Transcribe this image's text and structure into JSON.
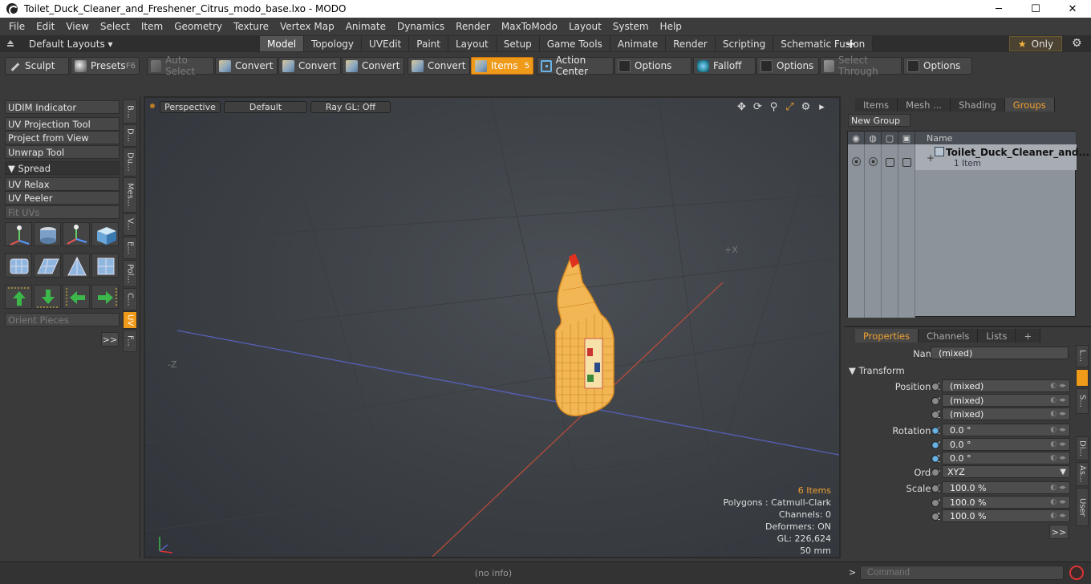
{
  "window": {
    "title": "Toilet_Duck_Cleaner_and_Freshener_Citrus_modo_base.lxo - MODO",
    "minimize": "─",
    "maximize": "☐",
    "close": "✕"
  },
  "menu": [
    "File",
    "Edit",
    "View",
    "Select",
    "Item",
    "Geometry",
    "Texture",
    "Vertex Map",
    "Animate",
    "Dynamics",
    "Render",
    "MaxToModo",
    "Layout",
    "System",
    "Help"
  ],
  "layoutbar": {
    "layouts_label": "Default Layouts ▾",
    "tabs": [
      "Model",
      "Topology",
      "UVEdit",
      "Paint",
      "Layout",
      "Setup",
      "Game Tools",
      "Animate",
      "Render",
      "Scripting",
      "Schematic Fusion"
    ],
    "active_tab": "Model",
    "plus": "+",
    "only_label": "Only",
    "star": "★",
    "gear": "⚙"
  },
  "toolbar": {
    "sculpt": "Sculpt",
    "presets": "Presets",
    "presets_key": "F6",
    "auto_select": "Auto Select",
    "convert1": "Convert",
    "convert2": "Convert",
    "convert3": "Convert",
    "convert4": "Convert",
    "items": "Items",
    "items_key": "5",
    "action_center": "Action Center",
    "options1": "Options",
    "falloff": "Falloff",
    "options2": "Options",
    "select_through": "Select Through",
    "options3": "Options"
  },
  "leftpanel": {
    "udim": "UDIM Indicator",
    "uv_projection": "UV Projection Tool",
    "project_from_view": "Project from View",
    "unwrap": "Unwrap Tool",
    "spread": "▼  Spread",
    "uv_relax": "UV Relax",
    "uv_peeler": "UV Peeler",
    "fit_uvs": "Fit UVs",
    "orient_pieces": "Orient Pieces",
    "more": ">>",
    "vtabs": [
      "B...",
      "D...",
      "Du...",
      "Mes...",
      "V...",
      "E...",
      "Pol...",
      "C...",
      "UV",
      "F..."
    ],
    "active_vtab": "UV"
  },
  "viewport": {
    "view": "Perspective",
    "shading": "Default",
    "raygl": "Ray GL: Off",
    "axis_x": "+X",
    "axis_z": "-Z",
    "stats": {
      "items": "6 Items",
      "polygons": "Polygons : Catmull-Clark",
      "channels": "Channels: 0",
      "deformers": "Deformers: ON",
      "gl": "GL: 226,624",
      "focal": "50 mm"
    },
    "tools": [
      "✥",
      "⟳",
      "⚲",
      "⤢",
      "⚙",
      "▸"
    ]
  },
  "groups_panel": {
    "tabs": [
      "Items",
      "Mesh ...",
      "Shading",
      "Groups"
    ],
    "active_tab": "Groups",
    "new_group": "New Group",
    "col_name": "Name",
    "row_name": "Toilet_Duck_Cleaner_and...",
    "row_sub": "1 Item",
    "expand": "+"
  },
  "properties_panel": {
    "tabs": [
      "Properties",
      "Channels",
      "Lists"
    ],
    "active_tab": "Properties",
    "plus": "+",
    "name_label": "Name",
    "name_value": "(mixed)",
    "transform_label": "▼  Transform",
    "position_x_label": "Position X",
    "position_x": "(mixed)",
    "position_y_label": "Y",
    "position_y": "(mixed)",
    "position_z_label": "Z",
    "position_z": "(mixed)",
    "rotation_x_label": "Rotation X",
    "rotation_x": "0.0 °",
    "rotation_y_label": "Y",
    "rotation_y": "0.0 °",
    "rotation_z_label": "Z",
    "rotation_z": "0.0 °",
    "order_label": "Order",
    "order_value": "XYZ",
    "scale_x_label": "Scale X",
    "scale_x": "100.0 %",
    "scale_y_label": "Y",
    "scale_y": "100.0 %",
    "scale_z_label": "Z",
    "scale_z": "100.0 %",
    "more": ">>",
    "vtabs": [
      "L...",
      "",
      "S...",
      "Di...",
      "As...",
      "User"
    ]
  },
  "statusbar": {
    "info": "(no info)",
    "cmd_arrow": ">",
    "command_placeholder": "Command"
  },
  "colors": {
    "accent": "#f09a1a",
    "selection_blue": "#6ab4e8",
    "mesh_orange": "#f0a030"
  }
}
